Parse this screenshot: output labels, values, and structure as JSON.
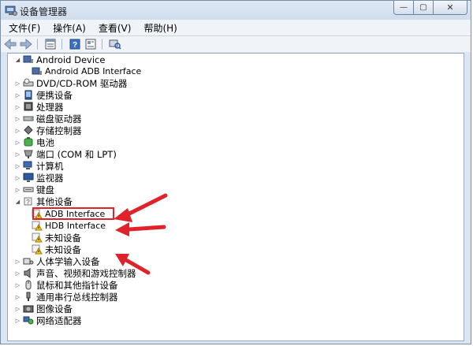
{
  "window": {
    "title": "设备管理器"
  },
  "menu": [
    "文件(F)",
    "操作(A)",
    "查看(V)",
    "帮助(H)"
  ],
  "toolbar": {
    "back_icon": "back-arrow-icon",
    "forward_icon": "forward-arrow-icon",
    "properties_icon": "properties-icon",
    "help_icon": "help-icon",
    "view_icon": "view-icon",
    "scan_icon": "scan-hardware-icon"
  },
  "tree": {
    "android_device": "Android Device",
    "android_adb": "Android ADB Interface",
    "dvd": "DVD/CD-ROM 驱动器",
    "portable": "便携设备",
    "processor": "处理器",
    "disk": "磁盘驱动器",
    "storage": "存储控制器",
    "battery": "电池",
    "ports": "端口 (COM 和 LPT)",
    "computer": "计算机",
    "monitor": "监视器",
    "keyboard": "键盘",
    "other": "其他设备",
    "adb_interface": "ADB Interface",
    "hdb_interface": "HDB Interface",
    "unknown1": "未知设备",
    "unknown2": "未知设备",
    "hid": "人体学输入设备",
    "sound": "声音、视频和游戏控制器",
    "mouse": "鼠标和其他指针设备",
    "usb": "通用串行总线控制器",
    "imaging": "图像设备",
    "network": "网络适配器"
  },
  "colors": {
    "annotation_red": "#e0222a",
    "warning_yellow": "#f2c81f"
  }
}
